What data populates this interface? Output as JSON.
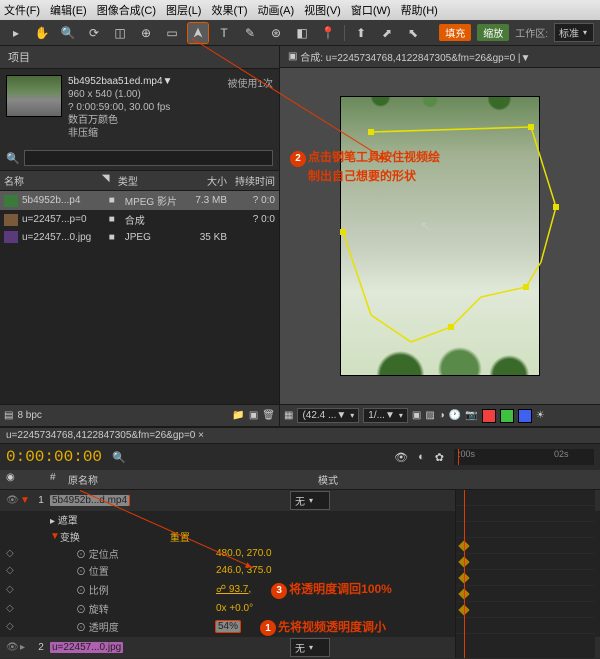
{
  "menu": {
    "file": "文件(F)",
    "edit": "编辑(E)",
    "comp": "图像合成(C)",
    "layer": "图层(L)",
    "effect": "效果(T)",
    "anim": "动画(A)",
    "view": "视图(V)",
    "window": "窗口(W)",
    "help": "帮助(H)"
  },
  "toolbar": {
    "fill": "填充",
    "zoom": "缩放",
    "workspace_label": "工作区:",
    "workspace_value": "标准"
  },
  "project": {
    "tab": "项目",
    "selected_name": "5b4952baa51ed.mp4▼",
    "selected_used": "被使用1次",
    "dims": "960 x 540 (1.00)",
    "fps": "? 0:00:59:00, 30.00 fps",
    "colors": "数百万颜色",
    "compress": "非压缩",
    "headers": {
      "name": "名称",
      "label": "◥",
      "type": "类型",
      "size": "大小",
      "dur": "持续时间"
    },
    "rows": [
      {
        "name": "5b4952b...p4",
        "type": "MPEG 影片",
        "size": "7.3 MB",
        "dur": "? 0:0",
        "sel": true,
        "icon": "ic-mpeg"
      },
      {
        "name": "u=22457...p=0",
        "type": "合成",
        "size": "",
        "dur": "? 0:0",
        "icon": "ic-comp"
      },
      {
        "name": "u=22457...0.jpg",
        "type": "JPEG",
        "size": "35 KB",
        "dur": "",
        "icon": "ic-jpeg"
      }
    ],
    "footer_bpc": "8 bpc"
  },
  "viewer": {
    "comp_label": "合成: u=2245734768,4122847305&fm=26&gp=0  |▼",
    "zoom": "(42.4 ...▼",
    "res": "1/...▼",
    "annot2": "点击钢笔工具按住视频绘",
    "annot2b": "制出自己想要的形状"
  },
  "timeline": {
    "tab": "u=2245734768,4122847305&fm=26&gp=0 ×",
    "timecode": "0:00:00:00",
    "ruler": {
      "t1": ":00s",
      "t2": "02s"
    },
    "cols": {
      "c1": "◉",
      "c2": "●",
      "c3": "#",
      "c4": "原名称",
      "c5": "模式"
    },
    "layers": [
      {
        "num": "1",
        "name": "5b4952b...d.mp4",
        "mode": "无",
        "twirl": true,
        "sel": true
      },
      {
        "num": "2",
        "name": "u=22457...0.jpg",
        "mode": "无",
        "twirl": false
      }
    ],
    "groups": {
      "mask": "遮罩",
      "transform": "变换",
      "reset": "重置"
    },
    "props": [
      {
        "name": "定位点",
        "val": "480.0, 270.0"
      },
      {
        "name": "位置",
        "val": "246.0, 375.0"
      },
      {
        "name": "比例",
        "val": "93.7,",
        "link": true
      },
      {
        "name": "旋转",
        "val": "0x +0.0°"
      },
      {
        "name": "透明度",
        "val": "54%",
        "boxed": true
      }
    ],
    "annot3": "将透明度调回100%",
    "annot1": "先将视频透明度调小"
  }
}
